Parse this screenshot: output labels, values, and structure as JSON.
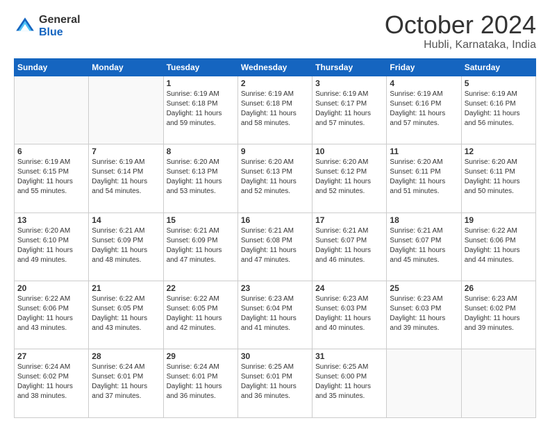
{
  "logo": {
    "general": "General",
    "blue": "Blue"
  },
  "header": {
    "month": "October 2024",
    "location": "Hubli, Karnataka, India"
  },
  "weekdays": [
    "Sunday",
    "Monday",
    "Tuesday",
    "Wednesday",
    "Thursday",
    "Friday",
    "Saturday"
  ],
  "weeks": [
    [
      {
        "day": "",
        "info": ""
      },
      {
        "day": "",
        "info": ""
      },
      {
        "day": "1",
        "info": "Sunrise: 6:19 AM\nSunset: 6:18 PM\nDaylight: 11 hours\nand 59 minutes."
      },
      {
        "day": "2",
        "info": "Sunrise: 6:19 AM\nSunset: 6:18 PM\nDaylight: 11 hours\nand 58 minutes."
      },
      {
        "day": "3",
        "info": "Sunrise: 6:19 AM\nSunset: 6:17 PM\nDaylight: 11 hours\nand 57 minutes."
      },
      {
        "day": "4",
        "info": "Sunrise: 6:19 AM\nSunset: 6:16 PM\nDaylight: 11 hours\nand 57 minutes."
      },
      {
        "day": "5",
        "info": "Sunrise: 6:19 AM\nSunset: 6:16 PM\nDaylight: 11 hours\nand 56 minutes."
      }
    ],
    [
      {
        "day": "6",
        "info": "Sunrise: 6:19 AM\nSunset: 6:15 PM\nDaylight: 11 hours\nand 55 minutes."
      },
      {
        "day": "7",
        "info": "Sunrise: 6:19 AM\nSunset: 6:14 PM\nDaylight: 11 hours\nand 54 minutes."
      },
      {
        "day": "8",
        "info": "Sunrise: 6:20 AM\nSunset: 6:13 PM\nDaylight: 11 hours\nand 53 minutes."
      },
      {
        "day": "9",
        "info": "Sunrise: 6:20 AM\nSunset: 6:13 PM\nDaylight: 11 hours\nand 52 minutes."
      },
      {
        "day": "10",
        "info": "Sunrise: 6:20 AM\nSunset: 6:12 PM\nDaylight: 11 hours\nand 52 minutes."
      },
      {
        "day": "11",
        "info": "Sunrise: 6:20 AM\nSunset: 6:11 PM\nDaylight: 11 hours\nand 51 minutes."
      },
      {
        "day": "12",
        "info": "Sunrise: 6:20 AM\nSunset: 6:11 PM\nDaylight: 11 hours\nand 50 minutes."
      }
    ],
    [
      {
        "day": "13",
        "info": "Sunrise: 6:20 AM\nSunset: 6:10 PM\nDaylight: 11 hours\nand 49 minutes."
      },
      {
        "day": "14",
        "info": "Sunrise: 6:21 AM\nSunset: 6:09 PM\nDaylight: 11 hours\nand 48 minutes."
      },
      {
        "day": "15",
        "info": "Sunrise: 6:21 AM\nSunset: 6:09 PM\nDaylight: 11 hours\nand 47 minutes."
      },
      {
        "day": "16",
        "info": "Sunrise: 6:21 AM\nSunset: 6:08 PM\nDaylight: 11 hours\nand 47 minutes."
      },
      {
        "day": "17",
        "info": "Sunrise: 6:21 AM\nSunset: 6:07 PM\nDaylight: 11 hours\nand 46 minutes."
      },
      {
        "day": "18",
        "info": "Sunrise: 6:21 AM\nSunset: 6:07 PM\nDaylight: 11 hours\nand 45 minutes."
      },
      {
        "day": "19",
        "info": "Sunrise: 6:22 AM\nSunset: 6:06 PM\nDaylight: 11 hours\nand 44 minutes."
      }
    ],
    [
      {
        "day": "20",
        "info": "Sunrise: 6:22 AM\nSunset: 6:06 PM\nDaylight: 11 hours\nand 43 minutes."
      },
      {
        "day": "21",
        "info": "Sunrise: 6:22 AM\nSunset: 6:05 PM\nDaylight: 11 hours\nand 43 minutes."
      },
      {
        "day": "22",
        "info": "Sunrise: 6:22 AM\nSunset: 6:05 PM\nDaylight: 11 hours\nand 42 minutes."
      },
      {
        "day": "23",
        "info": "Sunrise: 6:23 AM\nSunset: 6:04 PM\nDaylight: 11 hours\nand 41 minutes."
      },
      {
        "day": "24",
        "info": "Sunrise: 6:23 AM\nSunset: 6:03 PM\nDaylight: 11 hours\nand 40 minutes."
      },
      {
        "day": "25",
        "info": "Sunrise: 6:23 AM\nSunset: 6:03 PM\nDaylight: 11 hours\nand 39 minutes."
      },
      {
        "day": "26",
        "info": "Sunrise: 6:23 AM\nSunset: 6:02 PM\nDaylight: 11 hours\nand 39 minutes."
      }
    ],
    [
      {
        "day": "27",
        "info": "Sunrise: 6:24 AM\nSunset: 6:02 PM\nDaylight: 11 hours\nand 38 minutes."
      },
      {
        "day": "28",
        "info": "Sunrise: 6:24 AM\nSunset: 6:01 PM\nDaylight: 11 hours\nand 37 minutes."
      },
      {
        "day": "29",
        "info": "Sunrise: 6:24 AM\nSunset: 6:01 PM\nDaylight: 11 hours\nand 36 minutes."
      },
      {
        "day": "30",
        "info": "Sunrise: 6:25 AM\nSunset: 6:01 PM\nDaylight: 11 hours\nand 36 minutes."
      },
      {
        "day": "31",
        "info": "Sunrise: 6:25 AM\nSunset: 6:00 PM\nDaylight: 11 hours\nand 35 minutes."
      },
      {
        "day": "",
        "info": ""
      },
      {
        "day": "",
        "info": ""
      }
    ]
  ]
}
